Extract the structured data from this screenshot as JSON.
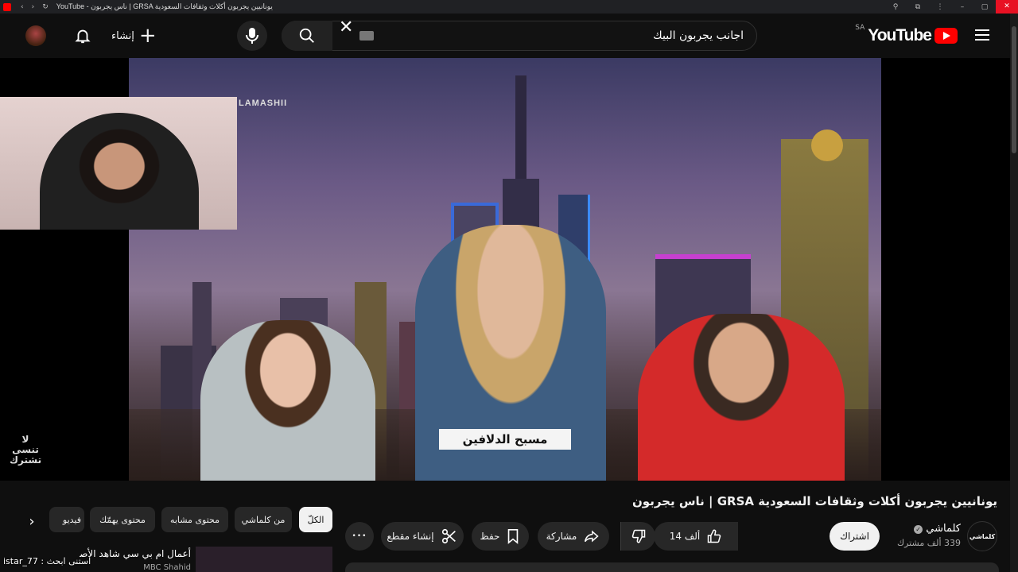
{
  "browser": {
    "tab_title": "YouTube - ناس يجربون | GRSA يونانيين يجربون أكلات وثقافات السعودية",
    "nav_glyphs": [
      "‹",
      "›",
      "↻"
    ],
    "window_controls": [
      "⚲",
      "⧉",
      "⋮",
      "–",
      "▢",
      "✕"
    ]
  },
  "masthead": {
    "logo_text": "YouTube",
    "country_code": "SA",
    "search_value": "اجانب يجربون البيك",
    "clear_glyph": "✕",
    "create_label": "إنشاء",
    "create_glyph": "+"
  },
  "player": {
    "watermark": "LAMASHII",
    "lower_third_caption": "مسبح الدلافين",
    "dont_forget": "لا تنسى تشترك"
  },
  "video": {
    "title": "يونانيين يجربون أكلات وثقافات السعودية GRSA | ناس يجربون",
    "channel_name": "كلماشي",
    "channel_logo_text": "كلماشي",
    "verified_glyph": "✓",
    "subscriber_count": "339 ألف مشترك",
    "subscribe_label": "اشتراك",
    "like_count": "14 ألف",
    "share_label": "مشاركة",
    "save_label": "حفظ",
    "clip_label": "إنشاء مقطع",
    "more_glyph": "•••"
  },
  "chips": {
    "items": [
      "الكلّ",
      "من كلماشي",
      "محتوى مشابه",
      "محتوى يهمّك",
      "فيديو"
    ],
    "active_index": 0,
    "chevron": "›"
  },
  "recommendation": {
    "title": "أعمال ام بي سي شاهد الأصلية",
    "channel": "MBC Shahid"
  },
  "stream_overlay": "istar_77 : استنى ابحث",
  "colors": {
    "brand_red": "#ff0000",
    "background": "#0f0f0f",
    "chip": "#272727"
  }
}
